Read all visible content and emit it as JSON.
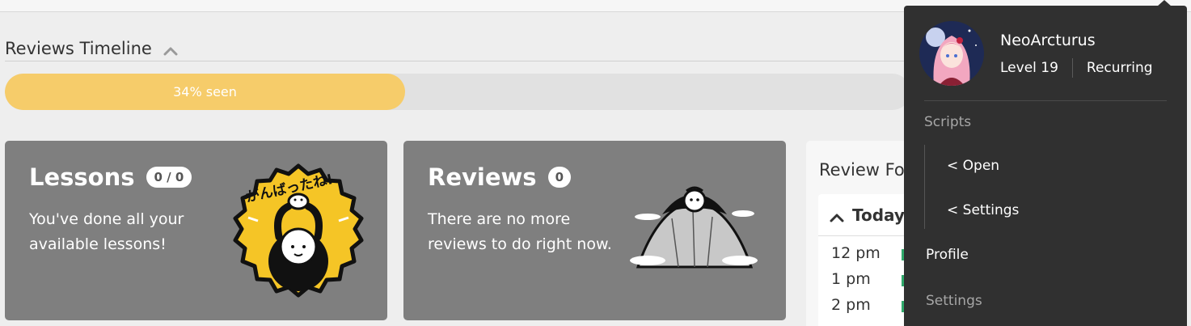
{
  "timeline": {
    "title": "Reviews Timeline",
    "progress_label": "34% seen",
    "progress_fraction": 0.34
  },
  "lessons": {
    "title": "Lessons",
    "badge": "0 / 0",
    "description": "You've done all your available lessons!",
    "art_text": "がんばったね!"
  },
  "reviews": {
    "title": "Reviews",
    "badge": "0",
    "description": "There are no more reviews to do right now."
  },
  "forecast": {
    "title": "Review Forecast",
    "today_label": "Today",
    "hours": [
      "12 pm",
      "1 pm",
      "2 pm"
    ]
  },
  "user_menu": {
    "username": "NeoArcturus",
    "level": "Level 19",
    "subscription": "Recurring",
    "scripts_label": "Scripts",
    "scripts_items": [
      "< Open",
      "< Settings"
    ],
    "profile_label": "Profile",
    "settings_label": "Settings"
  },
  "colors": {
    "progress_fill": "#f6cc6a",
    "card_bg": "#7f7f7f",
    "menu_bg": "#303030",
    "forecast_mark": "#2fa86a"
  }
}
